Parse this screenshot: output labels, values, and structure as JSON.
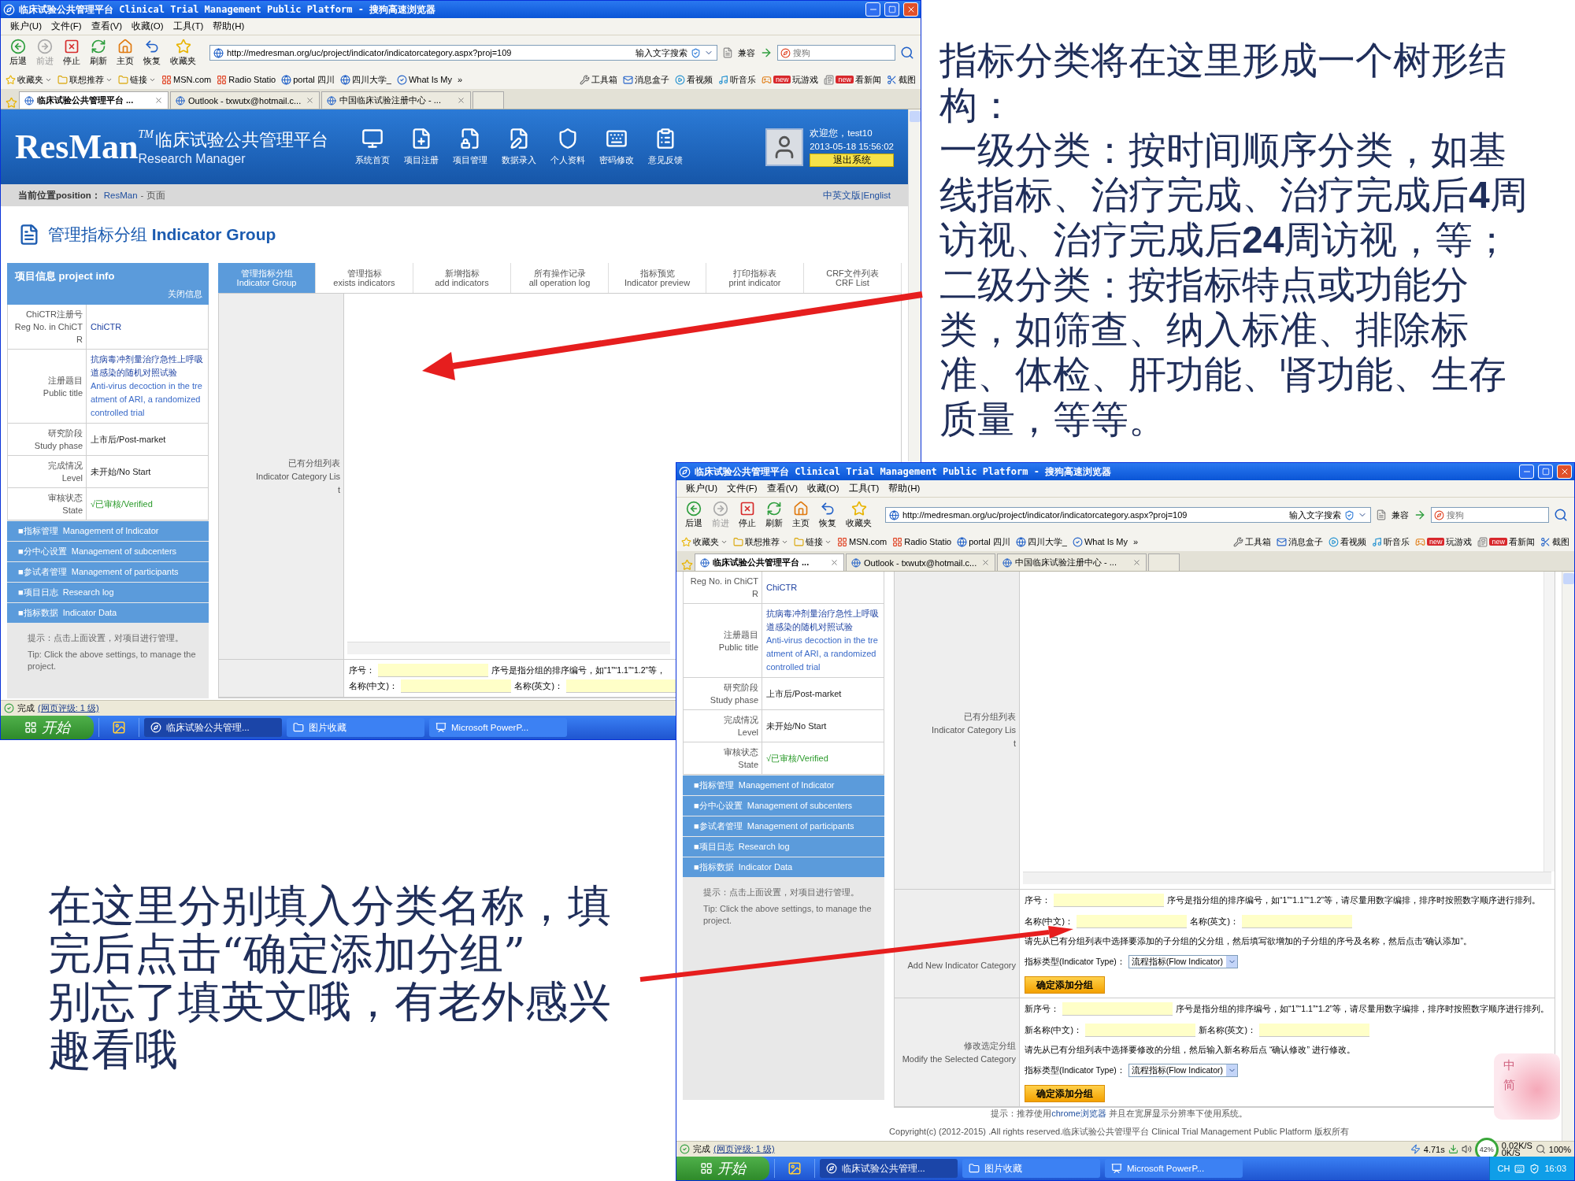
{
  "annotations": {
    "right": [
      "指标分类将在这里形成一个树形结构：",
      "一级分类：按时间顺序分类，如基线指标、治疗完成、治疗完成后**4**周访视、治疗完成后**24**周访视，等；",
      "二级分类：按指标特点或功能分类，如筛查、纳入标准、排除标准、体检、肝功能、肾功能、生存质量，等等。"
    ],
    "bottom": [
      "在这里分别填入分类名称，填完后点击“确定添加分组”",
      "别忘了填英文哦，有老外感兴趣看哦"
    ]
  },
  "windows": [
    {
      "title": "临床试验公共管理平台 Clinical Trial Management Public Platform - 搜狗高速浏览器",
      "menu": [
        "账户(U)",
        "文件(F)",
        "查看(V)",
        "收藏(O)",
        "工具(T)",
        "帮助(H)"
      ],
      "toolbar": [
        {
          "label": "后退",
          "disabled": false
        },
        {
          "label": "前进",
          "disabled": true
        },
        {
          "label": "停止",
          "disabled": false
        },
        {
          "label": "刷新",
          "disabled": false
        },
        {
          "label": "主页",
          "disabled": false
        },
        {
          "label": "恢复",
          "disabled": false
        },
        {
          "label": "收藏夹",
          "disabled": false
        }
      ],
      "address": "http://medresman.org/uc/project/indicator/indicatorcategory.aspx?proj=109",
      "search_label": "输入文字搜索",
      "compat": "兼容",
      "search": {
        "placeholder": "搜狗"
      },
      "links": [
        {
          "label": "收藏夹",
          "menu": true
        },
        {
          "label": "联想推荐",
          "menu": true
        },
        {
          "label": "链接",
          "menu": true
        },
        {
          "label": "MSN.com",
          "menu": false
        },
        {
          "label": "Radio Statio",
          "menu": false
        },
        {
          "label": "portal 四川",
          "menu": false
        },
        {
          "label": "四川大学_",
          "menu": false
        },
        {
          "label": "What Is My",
          "menu": false
        }
      ],
      "more": "»",
      "links_right": [
        {
          "label": "工具箱"
        },
        {
          "label": "消息盒子"
        },
        {
          "label": "看视频"
        },
        {
          "label": "听音乐"
        },
        {
          "label": "玩游戏",
          "badge": "new"
        },
        {
          "label": "看新闻",
          "badge": "new"
        },
        {
          "label": "截图"
        }
      ],
      "tabs": [
        {
          "label": "临床试验公共管理平台 ...",
          "selected": true
        },
        {
          "label": "Outlook - txwutx@hotmail.c...",
          "selected": false
        },
        {
          "label": "中国临床试验注册中心 - ...",
          "selected": false
        }
      ],
      "page": {
        "banner": {
          "logo": "ResMan",
          "tm": "TM",
          "cn": "临床试验公共管理平台",
          "en": "Research Manager",
          "nav": [
            "系统首页",
            "项目注册",
            "项目管理",
            "数据录入",
            "个人资料",
            "密码修改",
            "意见反馈"
          ],
          "welcome": "欢迎您，test10",
          "time": "2013-05-18 15:56:02",
          "logout": "退出系统"
        },
        "breadcrumb": {
          "label": "当前位置position：",
          "link": "ResMan",
          "rest": "- 页面",
          "lang": "中英文版|Englist"
        },
        "heading": "管理指标分组  **Indicator Group**",
        "info": {
          "title": "项目信息  project info",
          "close": "关闭信息",
          "rows": [
            {
              "label_cn": "ChiCTR注册号",
              "label_en": "Reg No. in ChiCTR",
              "values": [
                "ChiCTR"
              ],
              "kind": "link"
            },
            {
              "label_cn": "注册题目",
              "label_en": "Public title",
              "values": [
                "抗病毒冲剂量治疗急性上呼吸道感染的随机对照试验",
                "Anti-virus decoction in the treatment of ARI, a randomized controlled trial"
              ],
              "kind": "link"
            },
            {
              "label_cn": "研究阶段",
              "label_en": "Study phase",
              "values": [
                "上市后/Post-market"
              ],
              "kind": "plain"
            },
            {
              "label_cn": "完成情况",
              "label_en": "Level",
              "values": [
                "未开始/No Start"
              ],
              "kind": "plain"
            },
            {
              "label_cn": "审核状态",
              "label_en": "State",
              "values": [
                "√已审核/Verified"
              ],
              "kind": "ok"
            }
          ]
        },
        "nav": [
          "■指标管理  Management of Indicator",
          "■分中心设置  Management of subcenters",
          "■参试者管理  Management of participants",
          "■项目日志  Research log",
          "■指标数据  Indicator Data"
        ],
        "tip": [
          "提示：点击上面设置，对项目进行管理。",
          "Tip: Click the above settings, to manage the project."
        ],
        "tabs": [
          {
            "cn": "管理指标分组",
            "en": "Indicator Group",
            "selected": true
          },
          {
            "cn": "管理指标",
            "en": "exists indicators",
            "selected": false
          },
          {
            "cn": "新增指标",
            "en": "add indicators",
            "selected": false
          },
          {
            "cn": "所有操作记录",
            "en": "all operation log",
            "selected": false
          },
          {
            "cn": "指标预览",
            "en": "Indicator preview",
            "selected": false
          },
          {
            "cn": "打印指标表",
            "en": "print indicator",
            "selected": false
          },
          {
            "cn": "CRF文件列表",
            "en": "CRF List",
            "selected": false
          }
        ],
        "list_label": {
          "cn": "已有分组列表",
          "en": "Indicator Category List"
        },
        "forms": [
          {
            "rows": [
              [
                {
                  "kind": "text",
                  "text": "序号："
                },
                {
                  "kind": "input"
                },
                {
                  "kind": "text",
                  "text": "序号是指分组的排序编号，如“1”“1.1”“1.2”等，"
                }
              ],
              [
                {
                  "kind": "text",
                  "text": "名称(中文)："
                },
                {
                  "kind": "input"
                },
                {
                  "kind": "text",
                  "text": "名称(英文)："
                },
                {
                  "kind": "input"
                }
              ]
            ]
          }
        ]
      },
      "status": {
        "text": "完成",
        "link": "(网页评级: 1 级)"
      },
      "taskbar": {
        "start": "开始",
        "tasks": [
          {
            "label": "临床试验公共管理...",
            "selected": true
          },
          {
            "label": "图片收藏",
            "selected": false
          },
          {
            "label": "Microsoft PowerP...",
            "selected": false
          }
        ]
      }
    },
    {
      "title": "临床试验公共管理平台 Clinical Trial Management Public Platform - 搜狗高速浏览器",
      "menu": [
        "账户(U)",
        "文件(F)",
        "查看(V)",
        "收藏(O)",
        "工具(T)",
        "帮助(H)"
      ],
      "toolbar": [
        {
          "label": "后退",
          "disabled": false
        },
        {
          "label": "前进",
          "disabled": true
        },
        {
          "label": "停止",
          "disabled": false
        },
        {
          "label": "刷新",
          "disabled": false
        },
        {
          "label": "主页",
          "disabled": false
        },
        {
          "label": "恢复",
          "disabled": false
        },
        {
          "label": "收藏夹",
          "disabled": false
        }
      ],
      "address": "http://medresman.org/uc/project/indicator/indicatorcategory.aspx?proj=109",
      "search_label": "输入文字搜索",
      "compat": "兼容",
      "search": {
        "placeholder": "搜狗"
      },
      "links": [
        {
          "label": "收藏夹",
          "menu": true
        },
        {
          "label": "联想推荐",
          "menu": true
        },
        {
          "label": "链接",
          "menu": true
        },
        {
          "label": "MSN.com",
          "menu": false
        },
        {
          "label": "Radio Statio",
          "menu": false
        },
        {
          "label": "portal 四川",
          "menu": false
        },
        {
          "label": "四川大学_",
          "menu": false
        },
        {
          "label": "What Is My",
          "menu": false
        }
      ],
      "more": "»",
      "links_right": [
        {
          "label": "工具箱"
        },
        {
          "label": "消息盒子"
        },
        {
          "label": "看视频"
        },
        {
          "label": "听音乐"
        },
        {
          "label": "玩游戏",
          "badge": "new"
        },
        {
          "label": "看新闻",
          "badge": "new"
        },
        {
          "label": "截图"
        }
      ],
      "tabs": [
        {
          "label": "临床试验公共管理平台 ...",
          "selected": true
        },
        {
          "label": "Outlook - txwutx@hotmail.c...",
          "selected": false
        },
        {
          "label": "中国临床试验注册中心 - ...",
          "selected": false
        }
      ],
      "page": {
        "info": {
          "rows": [
            {
              "label_en": "Reg No. in ChiCTR",
              "values": [
                "ChiCTR"
              ],
              "kind": "link"
            },
            {
              "label_cn": "注册题目",
              "label_en": "Public title",
              "values": [
                "抗病毒冲剂量治疗急性上呼吸道感染的随机对照试验",
                "Anti-virus decoction in the treatment of ARI, a randomized controlled trial"
              ],
              "kind": "link"
            },
            {
              "label_cn": "研究阶段",
              "label_en": "Study phase",
              "values": [
                "上市后/Post-market"
              ],
              "kind": "plain"
            },
            {
              "label_cn": "完成情况",
              "label_en": "Level",
              "values": [
                "未开始/No Start"
              ],
              "kind": "plain"
            },
            {
              "label_cn": "审核状态",
              "label_en": "State",
              "values": [
                "√已审核/Verified"
              ],
              "kind": "ok"
            }
          ]
        },
        "nav": [
          "■指标管理  Management of Indicator",
          "■分中心设置  Management of subcenters",
          "■参试者管理  Management of participants",
          "■项目日志  Research log",
          "■指标数据  Indicator Data"
        ],
        "tip": [
          "提示：点击上面设置，对项目进行管理。",
          "Tip: Click the above settings, to manage the project."
        ],
        "list_label": {
          "cn": "已有分组列表",
          "en": "Indicator Category List"
        },
        "forms": [
          {
            "label_en": "Add New Indicator Category",
            "rows": [
              [
                {
                  "kind": "text",
                  "text": "序号："
                },
                {
                  "kind": "input"
                },
                {
                  "kind": "text",
                  "text": "序号是指分组的排序编号，如“1”“1.1”“1.2”等，请尽量用数字编排，排序时按照数字顺序进行排列。"
                }
              ],
              [
                {
                  "kind": "text",
                  "text": "名称(中文)："
                },
                {
                  "kind": "input"
                },
                {
                  "kind": "text",
                  "text": "名称(英文)："
                },
                {
                  "kind": "input"
                }
              ],
              [
                {
                  "kind": "text",
                  "text": "请先从已有分组列表中选择要添加的子分组的父分组，然后填写欲增加的子分组的序号及名称，然后点击“确认添加”。"
                }
              ],
              [
                {
                  "kind": "text",
                  "text": "指标类型(Indicator Type)："
                },
                {
                  "kind": "select",
                  "value": "流程指标(Flow Indicator)"
                }
              ],
              [
                {
                  "kind": "button",
                  "text": "确定添加分组"
                }
              ]
            ]
          },
          {
            "label_cn": "修改选定分组",
            "label_en": "Modify the Selected Category",
            "rows": [
              [
                {
                  "kind": "text",
                  "text": "新序号："
                },
                {
                  "kind": "input"
                },
                {
                  "kind": "text",
                  "text": "序号是指分组的排序编号，如“1”“1.1”“1.2”等，请尽量用数字编排，排序时按照数字顺序进行排列。"
                }
              ],
              [
                {
                  "kind": "text",
                  "text": "新名称(中文)："
                },
                {
                  "kind": "input"
                },
                {
                  "kind": "text",
                  "text": "新名称(英文)："
                },
                {
                  "kind": "input"
                }
              ],
              [
                {
                  "kind": "text",
                  "text": "请先从已有分组列表中选择要修改的分组，然后输入新名称后点 “确认修改” 进行修改。"
                }
              ],
              [
                {
                  "kind": "text",
                  "text": "指标类型(Indicator Type)："
                },
                {
                  "kind": "select",
                  "value": "流程指标(Flow Indicator)"
                }
              ],
              [
                {
                  "kind": "button",
                  "text": "确定添加分组"
                }
              ]
            ]
          }
        ],
        "footer": {
          "before": "提示：推荐使用",
          "link": "chrome浏览器",
          "after": " 并且在宽屏显示分辨率下使用系统。",
          "copyright": "Copyright(c) (2012-2015) .All rights reserved.临床试验公共管理平台  Clinical Trial Management Public Platform 版权所有"
        },
        "ime": [
          "中",
          "简"
        ]
      },
      "status": {
        "text": "完成",
        "link": "(网页评级: 1 级)",
        "load_time": "4.71s",
        "meter": "42%",
        "up": "0.02K/S",
        "down": "0K/S",
        "zoom": "100%"
      },
      "taskbar": {
        "start": "开始",
        "tasks": [
          {
            "label": "临床试验公共管理...",
            "selected": true
          },
          {
            "label": "图片收藏",
            "selected": false
          },
          {
            "label": "Microsoft PowerP...",
            "selected": false
          }
        ],
        "tray": {
          "lang": "CH",
          "clock": "16:03"
        }
      }
    }
  ]
}
